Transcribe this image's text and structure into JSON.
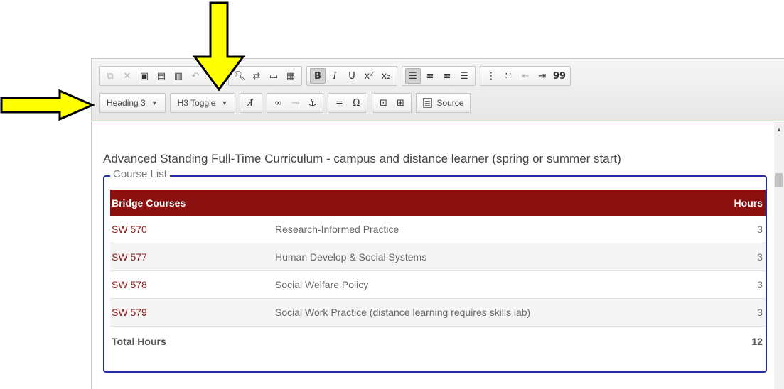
{
  "toolbar": {
    "format_combo": "Heading 3",
    "h3_toggle_combo": "H3 Toggle",
    "source_label": "Source",
    "buttons": {
      "bold": "B",
      "italic": "I",
      "underline": "U",
      "superscript": "x²",
      "subscript": "x₂",
      "omega": "Ω",
      "blockquote": "99"
    }
  },
  "content": {
    "heading": "Advanced Standing Full-Time Curriculum - campus and distance learner (spring or summer start)",
    "legend": "Course List",
    "table": {
      "header_left": "Bridge Courses",
      "header_right": "Hours",
      "rows": [
        {
          "code": "SW 570",
          "title": "Research-Informed Practice",
          "hours": "3"
        },
        {
          "code": "SW 577",
          "title": "Human Develop & Social Systems",
          "hours": "3"
        },
        {
          "code": "SW 578",
          "title": "Social Welfare Policy",
          "hours": "3"
        },
        {
          "code": "SW 579",
          "title": "Social Work Practice (distance learning requires skills lab)",
          "hours": "3"
        }
      ],
      "total_label": "Total Hours",
      "total_hours": "12"
    }
  },
  "colors": {
    "table_header": "#8b1111",
    "course_code": "#8b1a1a",
    "fieldset_border": "#1f2fa4",
    "arrow_fill": "#ffff00"
  }
}
